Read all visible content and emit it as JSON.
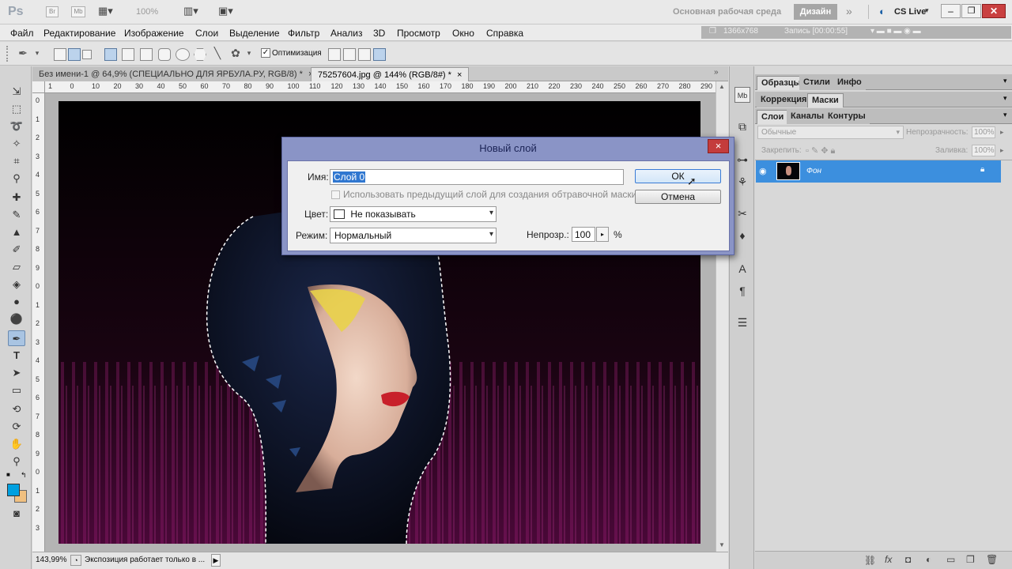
{
  "appbar": {
    "logo": "Ps",
    "zoom_level": "100%",
    "workspace_label": "Основная рабочая среда",
    "design_button": "Дизайн",
    "more": "»",
    "cs_live": "CS Live",
    "screen_size": "1366x768",
    "recording": "Запись [00:00:55]"
  },
  "menubar": {
    "items": [
      "Файл",
      "Редактирование",
      "Изображение",
      "Слои",
      "Выделение",
      "Фильтр",
      "Анализ",
      "3D",
      "Просмотр",
      "Окно",
      "Справка"
    ]
  },
  "options": {
    "optimization_label": "Оптимизация"
  },
  "documents": {
    "tabs": [
      {
        "label": "Без имени-1 @ 64,9% (СПЕЦИАЛЬНО ДЛЯ ЯРБУЛА.РУ, RGB/8) *"
      },
      {
        "label": "75257604.jpg @ 144% (RGB/8#) *"
      }
    ],
    "ruler_h": [
      "1",
      "0",
      "10",
      "20",
      "30",
      "40",
      "50",
      "60",
      "70",
      "80",
      "90",
      "100",
      "110",
      "120",
      "130",
      "140",
      "150",
      "160",
      "170",
      "180",
      "190",
      "200",
      "210",
      "220",
      "230",
      "240",
      "250",
      "260",
      "270",
      "280",
      "290"
    ],
    "ruler_v": [
      "0",
      "1",
      "2",
      "3",
      "4",
      "5",
      "6",
      "7",
      "8",
      "9",
      "0",
      "1",
      "2",
      "3",
      "4",
      "5",
      "6",
      "7",
      "8",
      "9",
      "0",
      "1",
      "2",
      "3"
    ]
  },
  "status": {
    "zoom": "143,99%",
    "message": "Экспозиция работает только в ..."
  },
  "panels": {
    "top_tabs": [
      "Образцы",
      "Стили",
      "Инфо"
    ],
    "mid_tabs": [
      "Коррекция",
      "Маски"
    ],
    "layer_tabs": [
      "Слои",
      "Каналы",
      "Контуры"
    ],
    "blend_mode": "Обычные",
    "opacity_label": "Непрозрачность:",
    "opacity_value": "100%",
    "lock_label": "Закрепить:",
    "fill_label": "Заливка:",
    "fill_value": "100%",
    "layer_name": "Фон"
  },
  "dialog": {
    "title": "Новый слой",
    "close": "×",
    "name_label": "Имя:",
    "name_value": "Слой 0",
    "clip_checkbox_label": "Использовать предыдущий слой для создания обтравочной маски",
    "color_label": "Цвет:",
    "color_value": "Не показывать",
    "mode_label": "Режим:",
    "mode_value": "Нормальный",
    "opacity_label": "Непрозр.:",
    "opacity_value": "100",
    "opacity_unit": "%",
    "ok": "ОК",
    "cancel": "Отмена"
  },
  "colors": {
    "accent_layer": "#3c8fde",
    "dialog_frame": "#8a94c6",
    "foreground": "#00a0e0",
    "background": "#f0c080"
  }
}
